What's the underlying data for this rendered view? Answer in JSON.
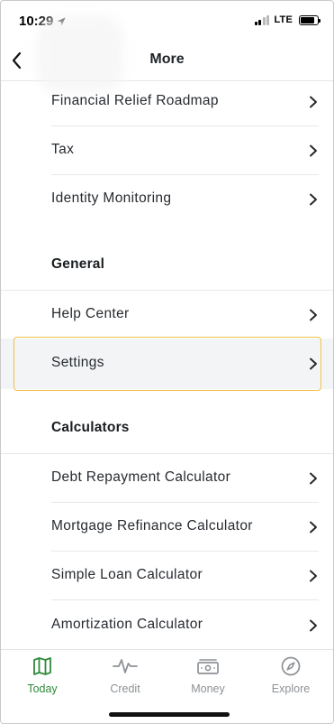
{
  "status_bar": {
    "time": "10:29",
    "network": "LTE"
  },
  "header": {
    "title": "More"
  },
  "items": [
    {
      "label": "Financial Relief Roadmap"
    },
    {
      "label": "Tax"
    },
    {
      "label": "Identity Monitoring"
    }
  ],
  "sections": {
    "general": {
      "title": "General",
      "items": [
        {
          "label": "Help Center"
        },
        {
          "label": "Settings",
          "selected": true
        }
      ]
    },
    "calculators": {
      "title": "Calculators",
      "items": [
        {
          "label": "Debt Repayment Calculator"
        },
        {
          "label": "Mortgage Refinance Calculator"
        },
        {
          "label": "Simple Loan Calculator"
        },
        {
          "label": "Amortization Calculator"
        }
      ]
    }
  },
  "tabbar": {
    "active": "today",
    "tabs": [
      {
        "id": "today",
        "label": "Today",
        "icon": "map-icon"
      },
      {
        "id": "credit",
        "label": "Credit",
        "icon": "pulse-icon"
      },
      {
        "id": "money",
        "label": "Money",
        "icon": "cash-icon"
      },
      {
        "id": "explore",
        "label": "Explore",
        "icon": "compass-icon"
      }
    ]
  },
  "colors": {
    "accent": "#2f8a3a",
    "selection_border": "#f0c24a",
    "selection_bg": "#f3f4f6",
    "inactive_tab": "#8d9196"
  }
}
